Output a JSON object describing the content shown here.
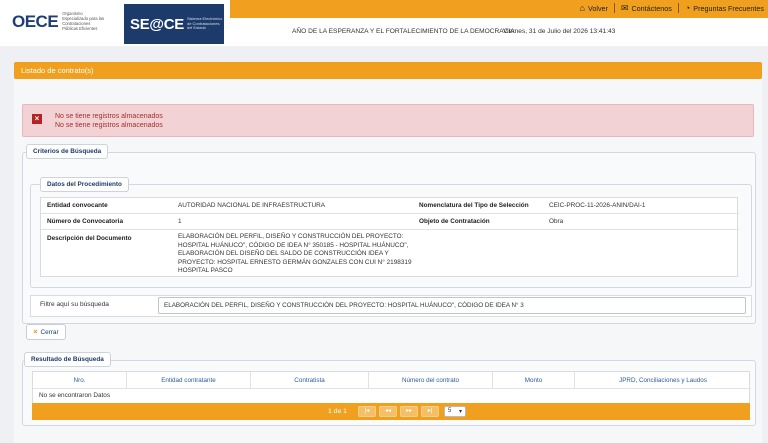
{
  "header": {
    "oece_logo_text": "OECE",
    "oece_subtitle": "Organismo Especializado para las Contrataciones Públicas Eficientes",
    "seace_logo_text": "SE@CE",
    "seace_subtitle": "Sistema Electrónico de Contrataciones del Estado",
    "nav": [
      {
        "label": "Volver",
        "icon": "home-icon"
      },
      {
        "label": "Contáctenos",
        "icon": "mail-icon"
      },
      {
        "label": "Preguntas Frecuentes",
        "icon": "rss-icon"
      }
    ],
    "motto": "AÑO DE LA ESPERANZA Y EL FORTALECIMIENTO DE LA DEMOCRACIA",
    "datetime": "Viernes, 31 de Julio del 2026  13:41:43"
  },
  "panel": {
    "title": "Listado de contrato(s)"
  },
  "alert": {
    "messages": [
      "No se tiene registros almacenados",
      "No se tiene registros almacenados"
    ]
  },
  "criteria": {
    "tab_label": "Criterios de Búsqueda",
    "procedure_tab": "Datos del Procedimiento",
    "entidad_label": "Entidad convocante",
    "entidad_value": "AUTORIDAD NACIONAL DE INFRAESTRUCTURA",
    "nomenclatura_label": "Nomenclatura del Tipo de Selección",
    "nomenclatura_value": "CEIC-PROC-11-2026-ANIN/DAI-1",
    "convocatoria_label": "Número de Convocatoria",
    "convocatoria_value": "1",
    "objeto_label": "Objeto de Contratación",
    "objeto_value": "Obra",
    "descripcion_label": "Descripción del Documento",
    "descripcion_lines": [
      "ELABORACIÓN DEL PERFIL, DISEÑO Y CONSTRUCCIÓN DEL PROYECTO:",
      "HOSPITAL HUÁNUCO\", CÓDIGO DE IDEA N° 350185 - HOSPITAL HUÁNUCO\",",
      "ELABORACIÓN DEL DISEÑO DEL SALDO DE CONSTRUCCIÓN IDEA Y",
      "PROYECTO: HOSPITAL ERNESTO GERMÁN GONZALES CON CUI N° 2198319",
      "HOSPITAL PASCO"
    ],
    "filter_label": "Filtre aquí su búsqueda",
    "filter_value": "ELABORACIÓN DEL PERFIL, DISEÑO Y CONSTRUCCIÓN DEL PROYECTO: HOSPITAL HUÁNUCO\", CÓDIGO DE IDEA N° 3",
    "close_button": "Cerrar"
  },
  "results": {
    "tab_label": "Resultado de Búsqueda",
    "columns": [
      "Nro.",
      "Entidad contratante",
      "Contratista",
      "Número del contrato",
      "Monto",
      "JPRD, Conciliaciones y Laudos"
    ],
    "empty_text": "No se encontraron Datos",
    "pager_text": "1 de 1",
    "pager_buttons": [
      "|◂",
      "◂◂",
      "▸▸",
      "▸|"
    ],
    "page_size": "5"
  }
}
